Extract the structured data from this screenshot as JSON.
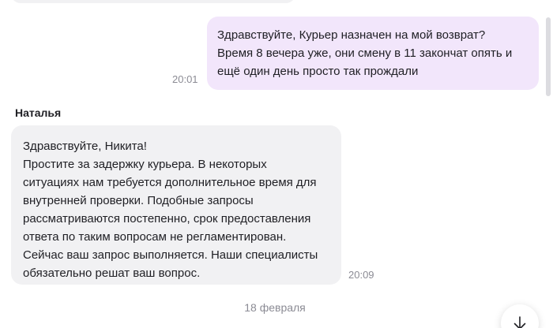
{
  "messages": {
    "outgoing": {
      "text": "Здравствуйте, Курьер назначен на мой возврат?\nВремя 8 вечера уже, они смену в 11 закончат опять и\nещё один день просто так прождали",
      "time": "20:01"
    },
    "incoming": {
      "sender": "Наталья",
      "text": "Здравствуйте, Никита!\nПростите за задержку курьера. В некоторых\nситуациях нам требуется дополнительное время для\nвнутренней проверки. Подобные запросы\nрассматриваются постепенно, срок предоставления\nответа по таким вопросам не регламентирован.\nСейчас ваш запрос выполняется. Наши специалисты\nобязательно решат ваш вопрос.",
      "time": "20:09"
    }
  },
  "date_separator": "18 февраля",
  "colors": {
    "outgoing_bubble": "#f2e6fb",
    "incoming_bubble": "#f1f1f3",
    "timestamp": "#8b8b94"
  },
  "icons": {
    "scroll_down": "arrow-down-icon"
  }
}
